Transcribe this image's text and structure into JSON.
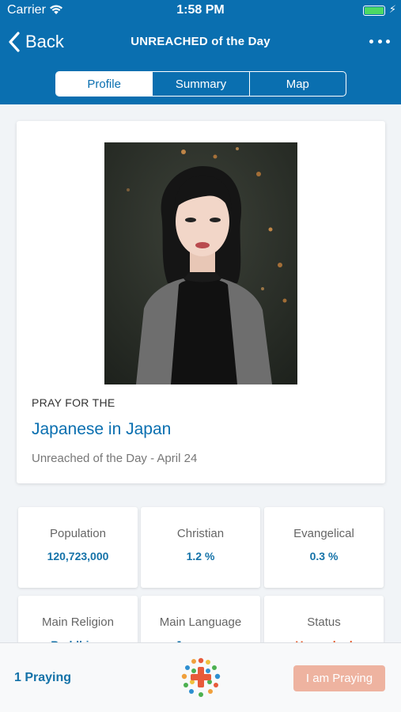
{
  "status_bar": {
    "carrier": "Carrier",
    "time": "1:58 PM"
  },
  "nav": {
    "back_label": "Back",
    "title": "UNREACHED of the Day",
    "tabs": [
      {
        "label": "Profile",
        "active": true
      },
      {
        "label": "Summary",
        "active": false
      },
      {
        "label": "Map",
        "active": false
      }
    ]
  },
  "profile": {
    "pray_for": "PRAY FOR THE",
    "people_name": "Japanese in Japan",
    "subtitle": "Unreached of the Day - April 24"
  },
  "stats": [
    {
      "label": "Population",
      "value": "120,723,000"
    },
    {
      "label": "Christian",
      "value": "1.2 %"
    },
    {
      "label": "Evangelical",
      "value": "0.3 %"
    },
    {
      "label": "Main Religion",
      "value": "Buddhism"
    },
    {
      "label": "Main Language",
      "value": "Japanese"
    },
    {
      "label": "Status",
      "value": "Unreached"
    }
  ],
  "bottom": {
    "praying_count": "1 Praying",
    "pray_button": "I am Praying"
  },
  "colors": {
    "brand_blue": "#0a6fb0",
    "value_blue": "#1472a8",
    "status_orange": "#e25a2d",
    "pray_button": "#eeb3a0"
  },
  "icons": [
    "wifi-icon",
    "battery-icon",
    "chevron-left-icon",
    "more-icon",
    "app-logo-icon"
  ]
}
